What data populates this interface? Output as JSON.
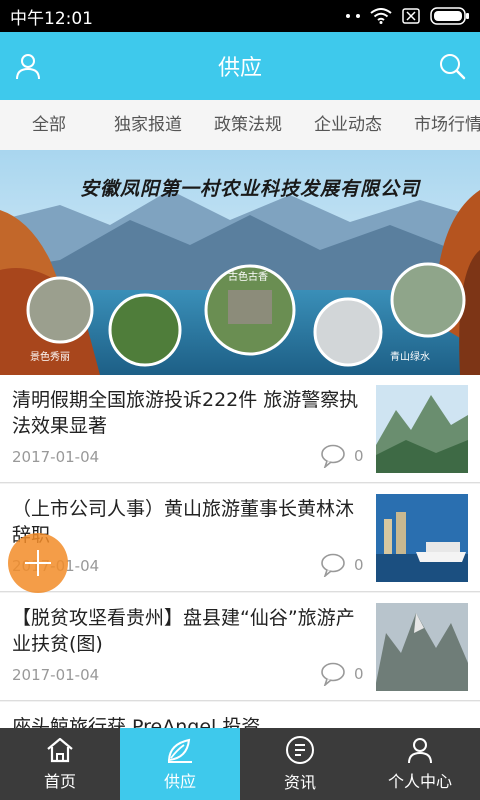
{
  "status_bar": {
    "time": "中午12:01"
  },
  "header": {
    "title": "供应"
  },
  "tabs": [
    "全部",
    "独家报道",
    "政策法规",
    "企业动态",
    "市场行情"
  ],
  "banner": {
    "company_name": "安徽凤阳第一村农业科技发展有限公司",
    "captions": [
      "景色秀丽",
      "古色古香",
      "青山绿水"
    ]
  },
  "news": [
    {
      "title": "清明假期全国旅游投诉222件 旅游警察执法效果显著",
      "date": "2017-01-04",
      "comments": "0"
    },
    {
      "title": "（上市公司人事）黄山旅游董事长黄林沐辞职",
      "date": "2017-01-04",
      "comments": "0"
    },
    {
      "title": "【脱贫攻坚看贵州】盘县建“仙谷”旅游产业扶贫(图)",
      "date": "2017-01-04",
      "comments": "0"
    },
    {
      "title": "座头鲸旅行获 PreAngel 投资"
    }
  ],
  "bottom_nav": [
    {
      "label": "首页",
      "icon": "home-icon"
    },
    {
      "label": "供应",
      "icon": "leaf-icon"
    },
    {
      "label": "资讯",
      "icon": "news-icon"
    },
    {
      "label": "个人中心",
      "icon": "person-icon"
    }
  ],
  "colors": {
    "accent": "#3ec9ec",
    "nav_bg": "#3b3b3b",
    "fab": "#f28c28"
  }
}
